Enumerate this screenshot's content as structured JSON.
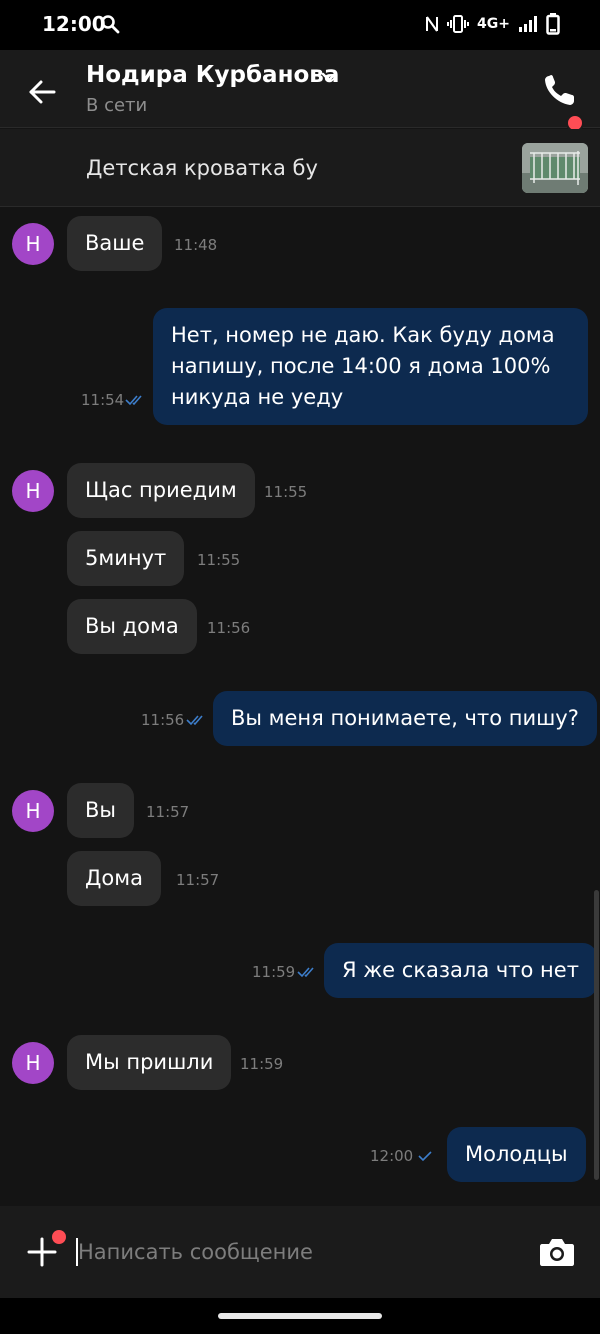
{
  "status_bar": {
    "time": "12:00",
    "network": "4G+",
    "icons": [
      "search-icon",
      "nfc-icon",
      "vibrate-icon",
      "signal-icon",
      "battery-icon"
    ]
  },
  "header": {
    "contact_name": "Нодира Курбанова",
    "contact_status": "В сети",
    "icons": [
      "back-arrow-icon",
      "chevron-down-icon",
      "phone-icon"
    ]
  },
  "listing": {
    "title": "Детская кроватка бу"
  },
  "avatar_letter": "Н",
  "messages": [
    {
      "dir": "in",
      "text": "Ваше",
      "time": "11:48",
      "avatar": true
    },
    {
      "dir": "out",
      "text": "Нет, номер не даю. Как буду дома напишу, после 14:00 я дома 100% никуда не уеду",
      "time": "11:54",
      "read": true
    },
    {
      "dir": "in",
      "text": "Щас приедим",
      "time": "11:55",
      "avatar": true
    },
    {
      "dir": "in",
      "text": "5минут",
      "time": "11:55"
    },
    {
      "dir": "in",
      "text": "Вы дома",
      "time": "11:56"
    },
    {
      "dir": "out",
      "text": "Вы меня понимаете, что пишу?",
      "time": "11:56",
      "read": true
    },
    {
      "dir": "in",
      "text": "Вы",
      "time": "11:57",
      "avatar": true
    },
    {
      "dir": "in",
      "text": "Дома",
      "time": "11:57"
    },
    {
      "dir": "out",
      "text": "Я же сказала что нет",
      "time": "11:59",
      "read": true
    },
    {
      "dir": "in",
      "text": "Мы пришли",
      "time": "11:59",
      "avatar": true
    },
    {
      "dir": "out",
      "text": "Молодцы",
      "time": "12:00",
      "read": false
    }
  ],
  "composer": {
    "placeholder": "Написать сообщение",
    "icons": [
      "plus-icon",
      "camera-icon"
    ]
  },
  "colors": {
    "background": "#141414",
    "bar": "#1b1b1b",
    "incoming_bubble": "#2c2c2c",
    "outgoing_bubble": "#0d2a4f",
    "avatar": "#a246c7",
    "notification_dot": "#ff4d55",
    "read_check": "#3d7ecb"
  }
}
